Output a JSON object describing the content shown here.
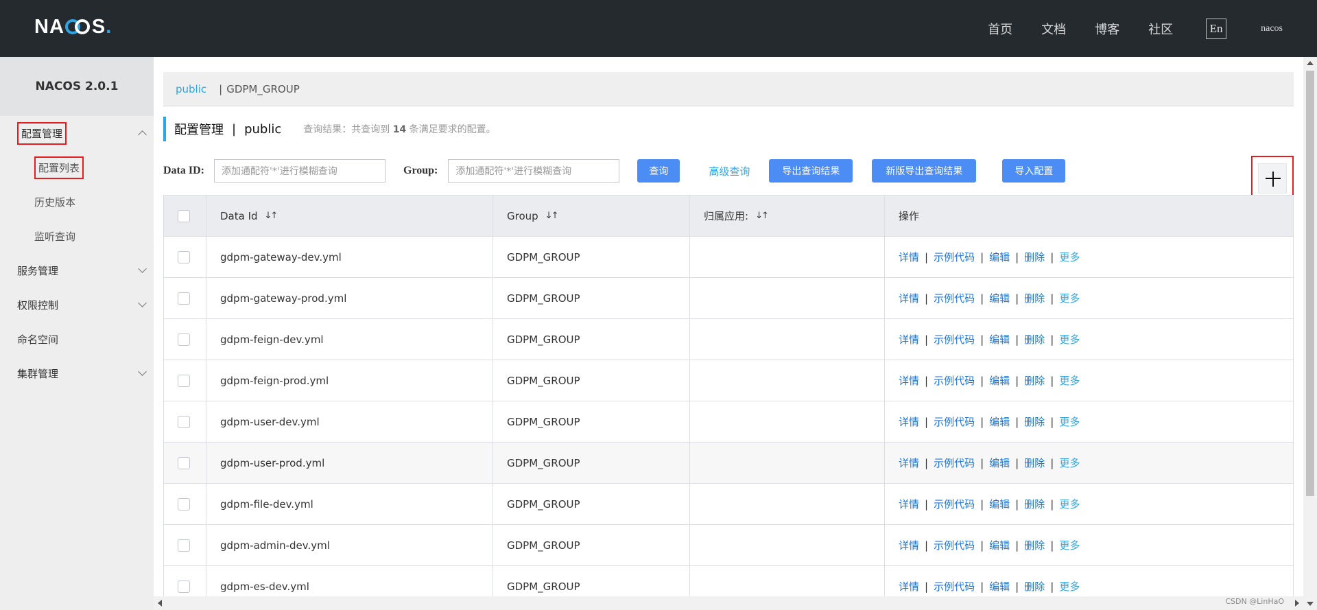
{
  "header": {
    "logo": {
      "pre": "NA",
      "post": "S",
      "dot": "."
    },
    "nav": [
      "首页",
      "文档",
      "博客",
      "社区"
    ],
    "lang": "En",
    "user": "nacos"
  },
  "sidebar": {
    "version": "NACOS 2.0.1",
    "items": [
      {
        "label": "配置管理",
        "expanded": true
      },
      {
        "label": "配置列表"
      },
      {
        "label": "历史版本"
      },
      {
        "label": "监听查询"
      },
      {
        "label": "服务管理"
      },
      {
        "label": "权限控制"
      },
      {
        "label": "命名空间"
      },
      {
        "label": "集群管理"
      }
    ]
  },
  "namespace_bar": {
    "current": "public",
    "sep": "|",
    "group": "GDPM_GROUP"
  },
  "title": {
    "main": "配置管理",
    "pipe": "|",
    "ns": "public",
    "result_pre": "查询结果：共查询到",
    "result_count": "14",
    "result_post": "条满足要求的配置。"
  },
  "search": {
    "dataid_label": "Data ID:",
    "dataid_placeholder": "添加通配符'*'进行模糊查询",
    "group_label": "Group:",
    "group_placeholder": "添加通配符'*'进行模糊查询",
    "query_btn": "查询",
    "advanced": "高级查询",
    "export_btn": "导出查询结果",
    "new_export_btn": "新版导出查询结果",
    "import_btn": "导入配置"
  },
  "table": {
    "columns": [
      "Data Id",
      "Group",
      "归属应用:",
      "操作"
    ],
    "sort_glyph": "↓↑",
    "ops": {
      "detail": "详情",
      "sample": "示例代码",
      "edit": "编辑",
      "delete": "删除",
      "more": "更多",
      "sep": "|"
    },
    "rows": [
      {
        "id": "gdpm-gateway-dev.yml",
        "group": "GDPM_GROUP",
        "app": ""
      },
      {
        "id": "gdpm-gateway-prod.yml",
        "group": "GDPM_GROUP",
        "app": ""
      },
      {
        "id": "gdpm-feign-dev.yml",
        "group": "GDPM_GROUP",
        "app": ""
      },
      {
        "id": "gdpm-feign-prod.yml",
        "group": "GDPM_GROUP",
        "app": ""
      },
      {
        "id": "gdpm-user-dev.yml",
        "group": "GDPM_GROUP",
        "app": ""
      },
      {
        "id": "gdpm-user-prod.yml",
        "group": "GDPM_GROUP",
        "app": ""
      },
      {
        "id": "gdpm-file-dev.yml",
        "group": "GDPM_GROUP",
        "app": ""
      },
      {
        "id": "gdpm-admin-dev.yml",
        "group": "GDPM_GROUP",
        "app": ""
      },
      {
        "id": "gdpm-es-dev.yml",
        "group": "GDPM_GROUP",
        "app": ""
      }
    ]
  },
  "watermark": "CSDN @LinHaO"
}
